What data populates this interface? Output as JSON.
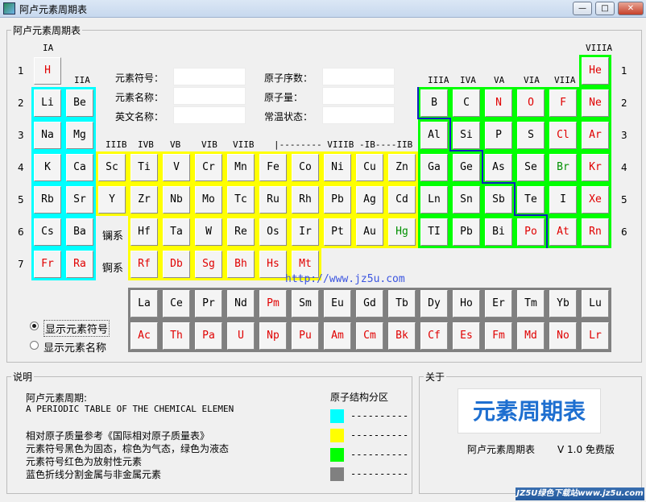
{
  "window": {
    "title": "阿卢元素周期表",
    "min": "0",
    "max": "1",
    "close": "r"
  },
  "table_group": {
    "legend": "阿卢元素周期表"
  },
  "groups": [
    "IA",
    "IIA",
    "IIIB",
    "IVB",
    "VB",
    "VIB",
    "VIIB",
    "|-------- VIIIB -IB----IIB",
    "IIIA",
    "IVA",
    "VA",
    "VIA",
    "VIIA",
    "VIIIA"
  ],
  "periods": [
    "1",
    "2",
    "3",
    "4",
    "5",
    "6",
    "7"
  ],
  "info": {
    "symbol_label": "元素符号：",
    "name_label": "元素名称：",
    "en_label": "英文名称：",
    "number_label": "原子序数：",
    "mass_label": "原子量：",
    "state_label": "常温状态：",
    "symbol_value": "",
    "name_value": "",
    "en_value": "",
    "number_value": "",
    "mass_value": "",
    "state_value": ""
  },
  "series_labels": {
    "lanthanide": "镧系",
    "actinide": "锕系"
  },
  "url": "http://www.jz5u.com",
  "elements": [
    {
      "s": "H",
      "zone": "pale",
      "c": "red"
    },
    {
      "s": "He",
      "zone": "green",
      "c": "red"
    },
    {
      "s": "Li",
      "zone": "cyan",
      "c": "blk"
    },
    {
      "s": "Be",
      "zone": "cyan",
      "c": "blk"
    },
    {
      "s": "B",
      "zone": "green",
      "c": "blk"
    },
    {
      "s": "C",
      "zone": "green",
      "c": "blk"
    },
    {
      "s": "N",
      "zone": "green",
      "c": "red"
    },
    {
      "s": "O",
      "zone": "green",
      "c": "red"
    },
    {
      "s": "F",
      "zone": "green",
      "c": "red"
    },
    {
      "s": "Ne",
      "zone": "green",
      "c": "red"
    },
    {
      "s": "Na",
      "zone": "cyan",
      "c": "blk"
    },
    {
      "s": "Mg",
      "zone": "cyan",
      "c": "blk"
    },
    {
      "s": "Al",
      "zone": "green",
      "c": "blk"
    },
    {
      "s": "Si",
      "zone": "green",
      "c": "blk"
    },
    {
      "s": "P",
      "zone": "green",
      "c": "blk"
    },
    {
      "s": "S",
      "zone": "green",
      "c": "blk"
    },
    {
      "s": "Cl",
      "zone": "green",
      "c": "red"
    },
    {
      "s": "Ar",
      "zone": "green",
      "c": "red"
    },
    {
      "s": "K",
      "zone": "cyan",
      "c": "blk"
    },
    {
      "s": "Ca",
      "zone": "cyan",
      "c": "blk"
    },
    {
      "s": "Sc",
      "zone": "yellow",
      "c": "blk"
    },
    {
      "s": "Ti",
      "zone": "yellow",
      "c": "blk"
    },
    {
      "s": "V",
      "zone": "yellow",
      "c": "blk"
    },
    {
      "s": "Cr",
      "zone": "yellow",
      "c": "blk"
    },
    {
      "s": "Mn",
      "zone": "yellow",
      "c": "blk"
    },
    {
      "s": "Fe",
      "zone": "yellow",
      "c": "blk"
    },
    {
      "s": "Co",
      "zone": "yellow",
      "c": "blk"
    },
    {
      "s": "Ni",
      "zone": "yellow",
      "c": "blk"
    },
    {
      "s": "Cu",
      "zone": "yellow",
      "c": "blk"
    },
    {
      "s": "Zn",
      "zone": "yellow",
      "c": "blk"
    },
    {
      "s": "Ga",
      "zone": "green",
      "c": "blk"
    },
    {
      "s": "Ge",
      "zone": "green",
      "c": "blk"
    },
    {
      "s": "As",
      "zone": "green",
      "c": "blk"
    },
    {
      "s": "Se",
      "zone": "green",
      "c": "blk"
    },
    {
      "s": "Br",
      "zone": "green",
      "c": "grn"
    },
    {
      "s": "Kr",
      "zone": "green",
      "c": "red"
    },
    {
      "s": "Rb",
      "zone": "cyan",
      "c": "blk"
    },
    {
      "s": "Sr",
      "zone": "cyan",
      "c": "blk"
    },
    {
      "s": "Y",
      "zone": "yellow",
      "c": "blk"
    },
    {
      "s": "Zr",
      "zone": "yellow",
      "c": "blk"
    },
    {
      "s": "Nb",
      "zone": "yellow",
      "c": "blk"
    },
    {
      "s": "Mo",
      "zone": "yellow",
      "c": "blk"
    },
    {
      "s": "Tc",
      "zone": "yellow",
      "c": "blk"
    },
    {
      "s": "Ru",
      "zone": "yellow",
      "c": "blk"
    },
    {
      "s": "Rh",
      "zone": "yellow",
      "c": "blk"
    },
    {
      "s": "Pb",
      "zone": "yellow",
      "c": "blk"
    },
    {
      "s": "Ag",
      "zone": "yellow",
      "c": "blk"
    },
    {
      "s": "Cd",
      "zone": "yellow",
      "c": "blk"
    },
    {
      "s": "Ln",
      "zone": "green",
      "c": "blk"
    },
    {
      "s": "Sn",
      "zone": "green",
      "c": "blk"
    },
    {
      "s": "Sb",
      "zone": "green",
      "c": "blk"
    },
    {
      "s": "Te",
      "zone": "green",
      "c": "blk"
    },
    {
      "s": "I",
      "zone": "green",
      "c": "blk"
    },
    {
      "s": "Xe",
      "zone": "green",
      "c": "red"
    },
    {
      "s": "Cs",
      "zone": "cyan",
      "c": "blk"
    },
    {
      "s": "Ba",
      "zone": "cyan",
      "c": "blk"
    },
    {
      "s": "Hf",
      "zone": "yellow",
      "c": "blk"
    },
    {
      "s": "Ta",
      "zone": "yellow",
      "c": "blk"
    },
    {
      "s": "W",
      "zone": "yellow",
      "c": "blk"
    },
    {
      "s": "Re",
      "zone": "yellow",
      "c": "blk"
    },
    {
      "s": "Os",
      "zone": "yellow",
      "c": "blk"
    },
    {
      "s": "Ir",
      "zone": "yellow",
      "c": "blk"
    },
    {
      "s": "Pt",
      "zone": "yellow",
      "c": "blk"
    },
    {
      "s": "Au",
      "zone": "yellow",
      "c": "blk"
    },
    {
      "s": "Hg",
      "zone": "yellow",
      "c": "grn"
    },
    {
      "s": "TI",
      "zone": "green",
      "c": "blk"
    },
    {
      "s": "Pb",
      "zone": "green",
      "c": "blk"
    },
    {
      "s": "Bi",
      "zone": "green",
      "c": "blk"
    },
    {
      "s": "Po",
      "zone": "green",
      "c": "red"
    },
    {
      "s": "At",
      "zone": "green",
      "c": "red"
    },
    {
      "s": "Rn",
      "zone": "green",
      "c": "red"
    },
    {
      "s": "Fr",
      "zone": "cyan",
      "c": "red"
    },
    {
      "s": "Ra",
      "zone": "cyan",
      "c": "red"
    },
    {
      "s": "Rf",
      "zone": "yellow",
      "c": "red"
    },
    {
      "s": "Db",
      "zone": "yellow",
      "c": "red"
    },
    {
      "s": "Sg",
      "zone": "yellow",
      "c": "red"
    },
    {
      "s": "Bh",
      "zone": "yellow",
      "c": "red"
    },
    {
      "s": "Hs",
      "zone": "yellow",
      "c": "red"
    },
    {
      "s": "Mt",
      "zone": "yellow",
      "c": "red"
    }
  ],
  "lanthanides": [
    {
      "s": "La",
      "c": "blk"
    },
    {
      "s": "Ce",
      "c": "blk"
    },
    {
      "s": "Pr",
      "c": "blk"
    },
    {
      "s": "Nd",
      "c": "blk"
    },
    {
      "s": "Pm",
      "c": "red"
    },
    {
      "s": "Sm",
      "c": "blk"
    },
    {
      "s": "Eu",
      "c": "blk"
    },
    {
      "s": "Gd",
      "c": "blk"
    },
    {
      "s": "Tb",
      "c": "blk"
    },
    {
      "s": "Dy",
      "c": "blk"
    },
    {
      "s": "Ho",
      "c": "blk"
    },
    {
      "s": "Er",
      "c": "blk"
    },
    {
      "s": "Tm",
      "c": "blk"
    },
    {
      "s": "Yb",
      "c": "blk"
    },
    {
      "s": "Lu",
      "c": "blk"
    }
  ],
  "actinides": [
    {
      "s": "Ac",
      "c": "red"
    },
    {
      "s": "Th",
      "c": "red"
    },
    {
      "s": "Pa",
      "c": "red"
    },
    {
      "s": "U",
      "c": "red"
    },
    {
      "s": "Np",
      "c": "red"
    },
    {
      "s": "Pu",
      "c": "red"
    },
    {
      "s": "Am",
      "c": "red"
    },
    {
      "s": "Cm",
      "c": "red"
    },
    {
      "s": "Bk",
      "c": "red"
    },
    {
      "s": "Cf",
      "c": "red"
    },
    {
      "s": "Es",
      "c": "red"
    },
    {
      "s": "Fm",
      "c": "red"
    },
    {
      "s": "Md",
      "c": "red"
    },
    {
      "s": "No",
      "c": "red"
    },
    {
      "s": "Lr",
      "c": "red"
    }
  ],
  "display": {
    "symbol_option": "显示元素符号",
    "name_option": "显示元素名称",
    "selected": "symbol"
  },
  "notes": {
    "legend": "说明",
    "line1": "阿卢元素周期:",
    "line2": "A PERIODIC TABLE OF THE CHEMICAL ELEMEN",
    "line3": "相对原子质量参考《国际相对原子质量表》",
    "line4": "元素符号黑色为固态，棕色为气态，绿色为液态",
    "line5": "元素符号红色为放射性元素",
    "line6": "蓝色折线分割金属与非金属元素",
    "structure_title": "原子结构分区",
    "swatch_text": "----------"
  },
  "zone_colors": {
    "cyan": "#00ffff",
    "yellow": "#ffff00",
    "green": "#00ff00",
    "gray": "#808080"
  },
  "about": {
    "legend": "关于",
    "logo": "元素周期表",
    "app_name": "阿卢元素周期表",
    "version": "V 1.0 免费版"
  },
  "watermark": "JZ5U绿色下载站www.jz5u.com"
}
